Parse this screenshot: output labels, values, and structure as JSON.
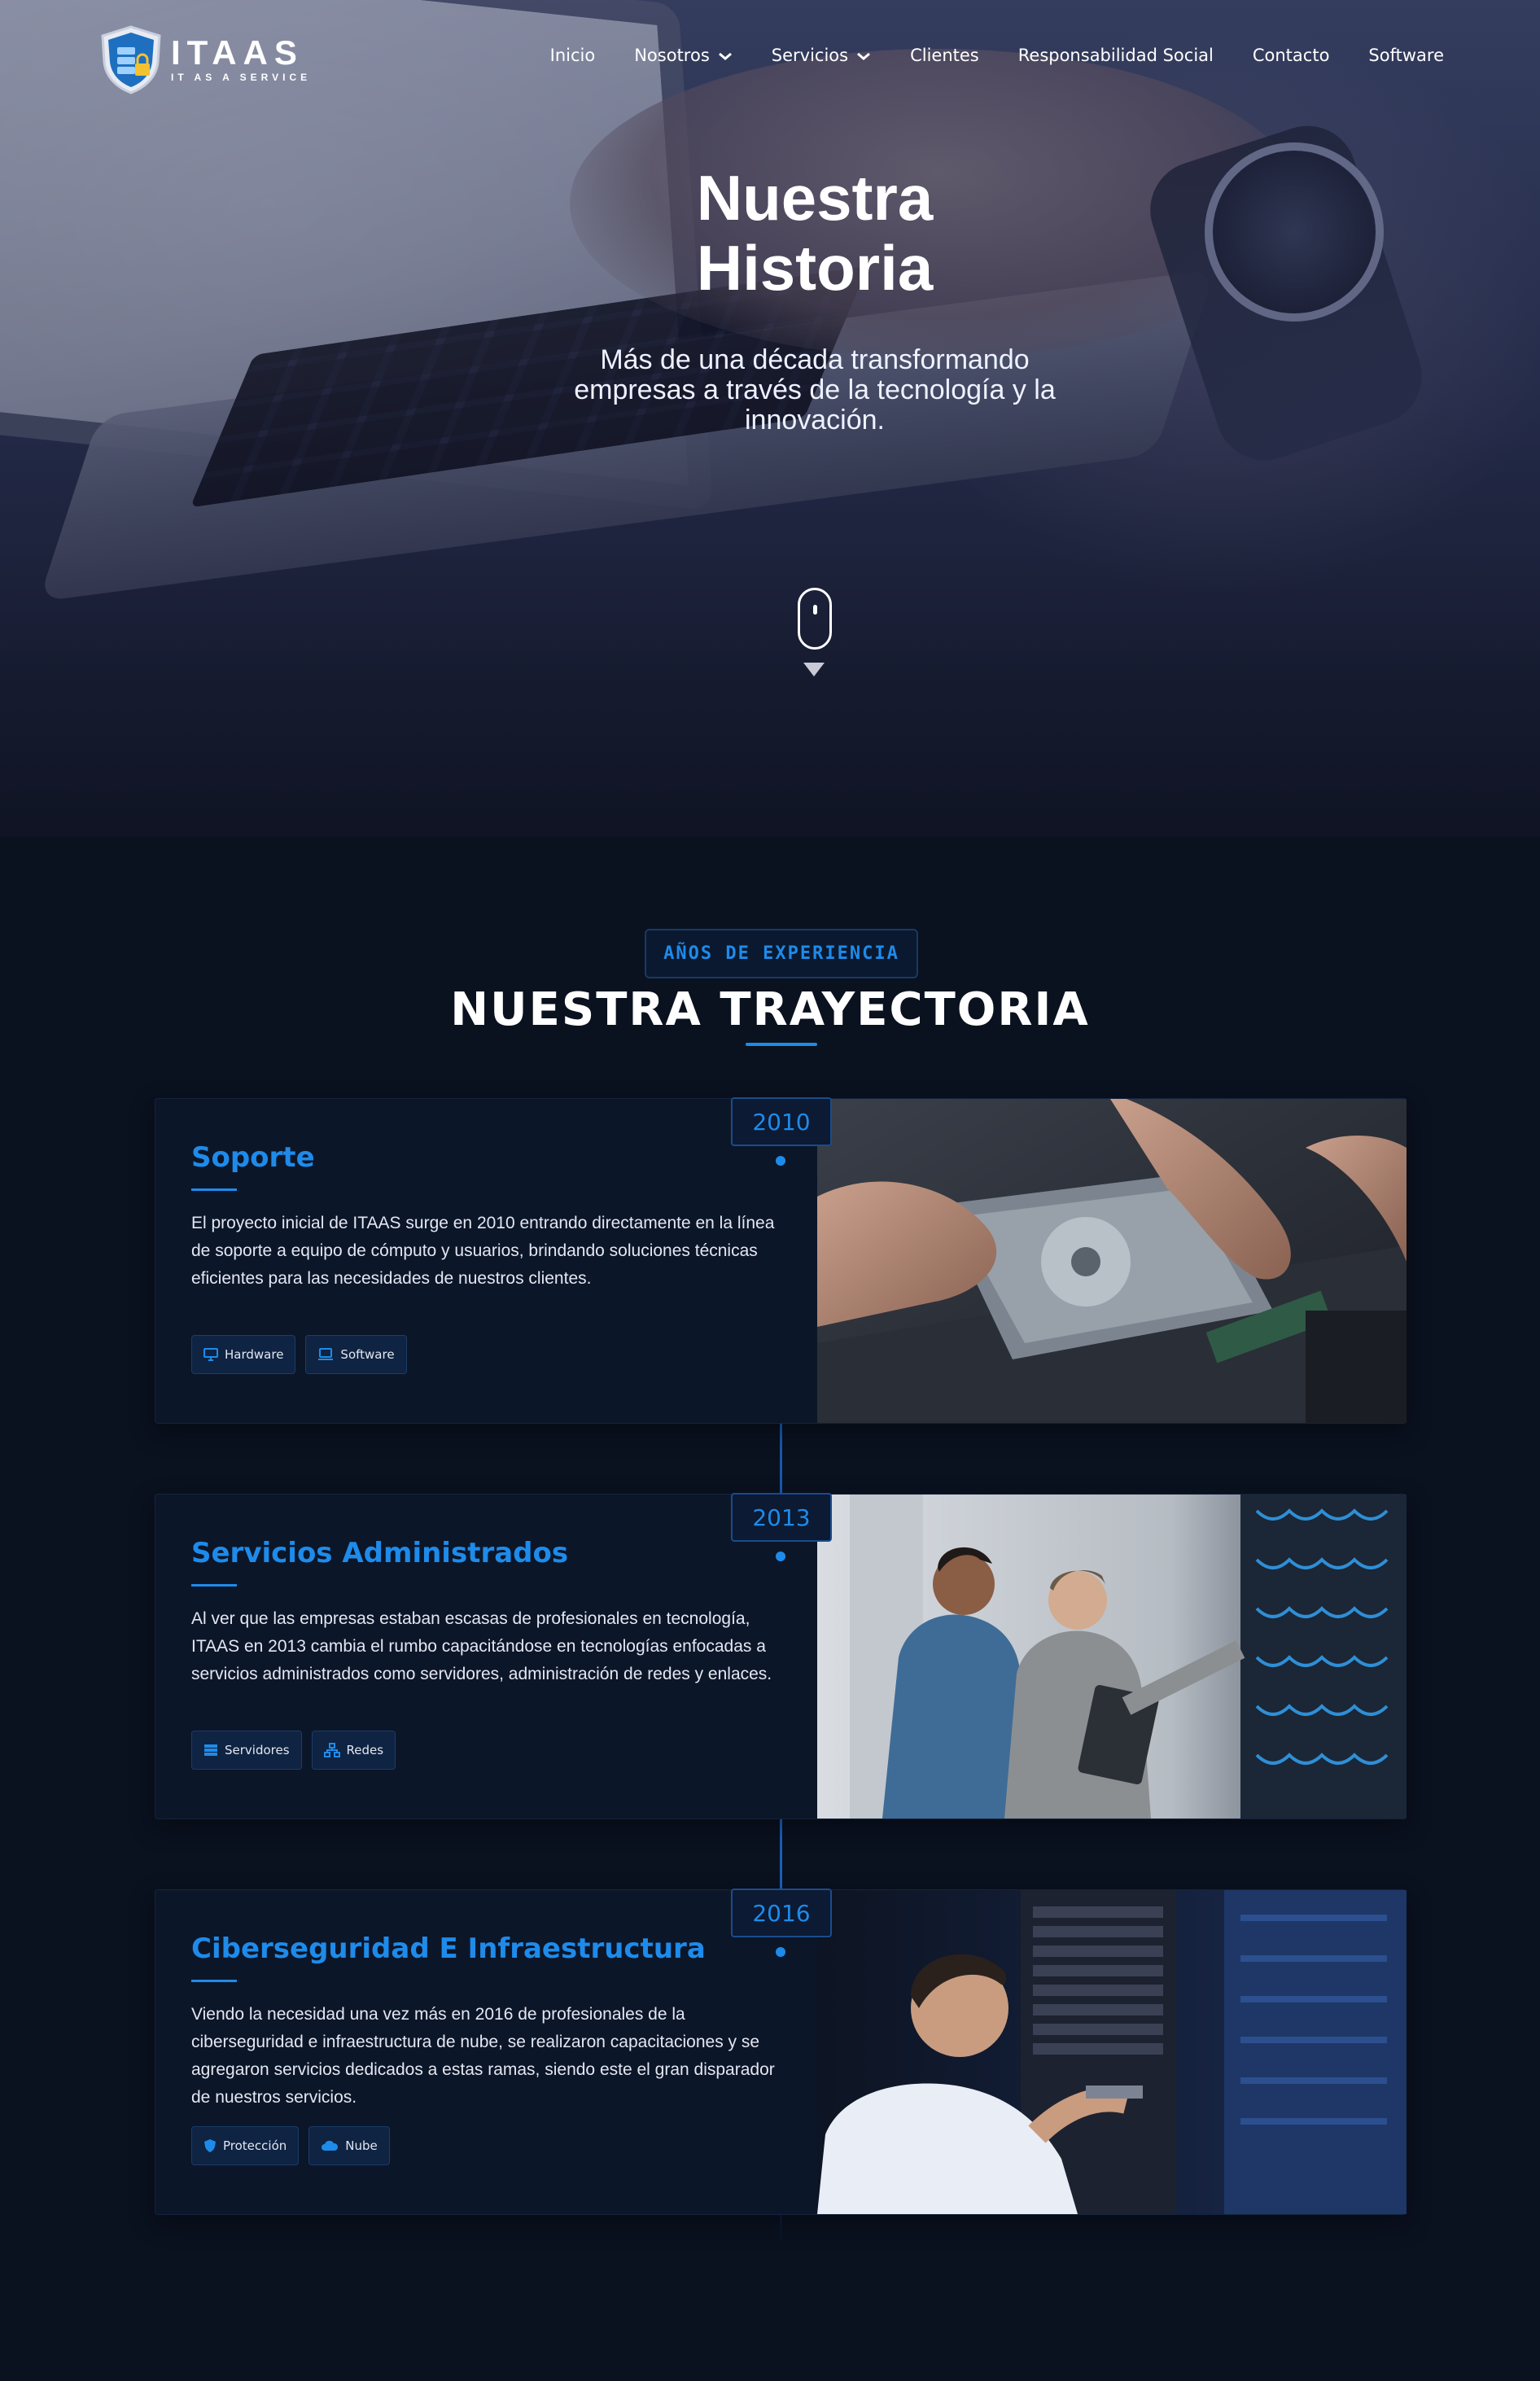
{
  "brand": {
    "name": "ITAAS",
    "tagline": "IT AS A SERVICE"
  },
  "nav": {
    "items": [
      {
        "label": "Inicio",
        "has_dropdown": false
      },
      {
        "label": "Nosotros",
        "has_dropdown": true
      },
      {
        "label": "Servicios",
        "has_dropdown": true
      },
      {
        "label": "Clientes",
        "has_dropdown": false
      },
      {
        "label": "Responsabilidad Social",
        "has_dropdown": false
      },
      {
        "label": "Contacto",
        "has_dropdown": false
      },
      {
        "label": "Software",
        "has_dropdown": false
      }
    ]
  },
  "hero": {
    "title_line1": "Nuestra",
    "title_line2": "Historia",
    "subtitle": "Más de una década transformando empresas a través de la tecnología y la innovación.",
    "scroll_icon": "mouse-scroll-icon"
  },
  "section": {
    "badge": "AÑOS DE EXPERIENCIA",
    "title": "NUESTRA TRAYECTORIA"
  },
  "timeline": [
    {
      "year": "2010",
      "title": "Soporte",
      "text": "El proyecto inicial de ITAAS surge en 2010 entrando directamente en la línea de soporte a equipo de cómputo y usuarios, brindando soluciones técnicas eficientes para las necesidades de nuestros clientes.",
      "tags": [
        {
          "label": "Hardware",
          "icon": "monitor-icon"
        },
        {
          "label": "Software",
          "icon": "laptop-icon"
        }
      ]
    },
    {
      "year": "2013",
      "title": "Servicios Administrados",
      "text": "Al ver que las empresas estaban escasas de profesionales en tecnología, ITAAS en 2013 cambia el rumbo capacitándose en tecnologías enfocadas a servicios administrados como servidores, administración de redes y enlaces.",
      "tags": [
        {
          "label": "Servidores",
          "icon": "server-icon"
        },
        {
          "label": "Redes",
          "icon": "network-icon"
        }
      ]
    },
    {
      "year": "2016",
      "title": "Ciberseguridad E Infraestructura",
      "text": "Viendo la necesidad una vez más en 2016 de profesionales de la ciberseguridad e infraestructura de nube, se realizaron capacitaciones y se agregaron servicios dedicados a estas ramas, siendo este el gran disparador de nuestros servicios.",
      "tags": [
        {
          "label": "Protección",
          "icon": "shield-icon"
        },
        {
          "label": "Nube",
          "icon": "cloud-icon"
        }
      ]
    }
  ],
  "colors": {
    "accent": "#1e8bea",
    "background": "#0a111f",
    "card": "#0c1629"
  }
}
